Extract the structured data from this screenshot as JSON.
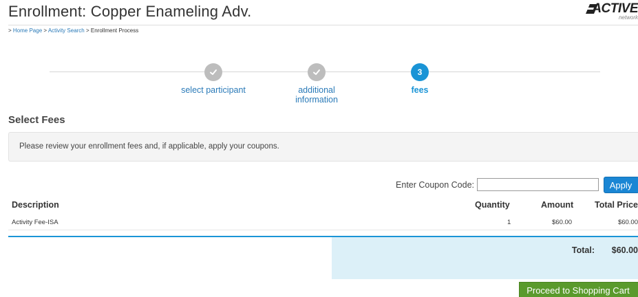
{
  "page": {
    "title": "Enrollment: Copper Enameling Adv.",
    "logo_text": "ACTIVE",
    "logo_sub": "network"
  },
  "breadcrumb": {
    "prefix": ">",
    "items": [
      "Home Page",
      "Activity Search",
      "Enrollment Process"
    ],
    "separator": ">"
  },
  "stepper": {
    "steps": [
      {
        "label": "select participant",
        "state": "completed",
        "icon": "check-icon"
      },
      {
        "label": "additional information",
        "state": "completed",
        "icon": "check-icon"
      },
      {
        "label": "fees",
        "number": "3",
        "state": "active"
      }
    ]
  },
  "fees": {
    "section_title": "Select Fees",
    "notice": "Please review your enrollment fees and, if applicable, apply your coupons.",
    "coupon_label": "Enter Coupon Code:",
    "coupon_value": "",
    "apply_label": "Apply"
  },
  "table": {
    "headers": {
      "description": "Description",
      "quantity": "Quantity",
      "amount": "Amount",
      "total_price": "Total Price"
    },
    "rows": [
      {
        "description": "Activity Fee-ISA",
        "quantity": "1",
        "amount": "$60.00",
        "total_price": "$60.00"
      }
    ],
    "total_label": "Total:",
    "total_value": "$60.00"
  },
  "actions": {
    "proceed_label": "Proceed to Shopping Cart"
  },
  "colors": {
    "accent": "#1a94d6",
    "link": "#2a7ab8",
    "completed_step": "#bdbdbd",
    "total_box": "#dcf0f8",
    "proceed_button": "#5a9a2c"
  }
}
